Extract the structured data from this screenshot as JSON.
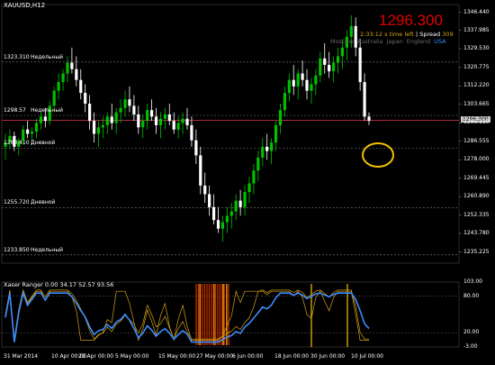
{
  "chart": {
    "symbol": "XAUUSD,H12",
    "current_price": "1296.300",
    "time_left": "2:33:12 s time left",
    "spread_label": "Spread",
    "spread_value": "309",
    "sessions": [
      "Moscow",
      "Australia",
      "Japan",
      "England",
      "USA"
    ],
    "active_session": "USA",
    "price_tag": "1296.300",
    "levels": [
      {
        "value": "1323.310",
        "name": "Недельный"
      },
      {
        "value": "1298.57",
        "name": "Недельный"
      },
      {
        "value": "1283.410",
        "name": "Дневной"
      },
      {
        "value": "1255.720",
        "name": "Дневной"
      },
      {
        "value": "1233.850",
        "name": "Недельный"
      }
    ],
    "price_axis": [
      "1346.440",
      "1337.985",
      "1329.530",
      "1320.775",
      "1312.220",
      "1303.665",
      "1295.110",
      "1286.555",
      "1278.000",
      "1269.445",
      "1260.890",
      "1252.335",
      "1243.780",
      "1235.225"
    ],
    "time_axis": [
      "31 Mar 2014",
      "10 Apr 00:00",
      "23 Apr 00:00",
      "5 May 00:00",
      "15 May 00:00",
      "27 May 00:00",
      "6 Jun 00:00",
      "18 Jun 00:00",
      "30 Jun 00:00",
      "10 Jul 00:00"
    ]
  },
  "indicator": {
    "label": "Xaser Ranger  0.00 34.17 52.57 93.56",
    "axis": [
      "103.00",
      "80.00",
      "20.00",
      "-3.00"
    ]
  },
  "colors": {
    "bull": "#00c000",
    "bear": "#ffffff",
    "current_line": "#c0304a",
    "level_line": "#808080",
    "circle": "#f0c000",
    "ind_blue": "#3b8cff",
    "ind_orange": "#d4a017",
    "ind_red": "#d03000"
  },
  "chart_data": {
    "type": "candlestick",
    "title": "XAUUSD,H12",
    "ylim": [
      1230,
      1350
    ],
    "ohlc": [
      [
        1284,
        1290,
        1278,
        1286
      ],
      [
        1286,
        1292,
        1283,
        1289
      ],
      [
        1289,
        1291,
        1282,
        1284
      ],
      [
        1284,
        1288,
        1280,
        1287
      ],
      [
        1287,
        1294,
        1285,
        1292
      ],
      [
        1292,
        1296,
        1288,
        1290
      ],
      [
        1290,
        1293,
        1285,
        1291
      ],
      [
        1291,
        1297,
        1288,
        1295
      ],
      [
        1295,
        1300,
        1292,
        1298
      ],
      [
        1298,
        1302,
        1293,
        1296
      ],
      [
        1296,
        1305,
        1294,
        1303
      ],
      [
        1303,
        1312,
        1300,
        1310
      ],
      [
        1310,
        1318,
        1306,
        1314
      ],
      [
        1314,
        1320,
        1310,
        1318
      ],
      [
        1318,
        1326,
        1314,
        1323
      ],
      [
        1323,
        1330,
        1318,
        1320
      ],
      [
        1320,
        1326,
        1312,
        1315
      ],
      [
        1315,
        1320,
        1306,
        1309
      ],
      [
        1309,
        1313,
        1300,
        1304
      ],
      [
        1304,
        1308,
        1292,
        1296
      ],
      [
        1296,
        1300,
        1286,
        1290
      ],
      [
        1290,
        1296,
        1284,
        1293
      ],
      [
        1293,
        1298,
        1288,
        1294
      ],
      [
        1294,
        1300,
        1290,
        1298
      ],
      [
        1298,
        1304,
        1292,
        1295
      ],
      [
        1295,
        1302,
        1290,
        1300
      ],
      [
        1300,
        1306,
        1295,
        1302
      ],
      [
        1302,
        1310,
        1298,
        1306
      ],
      [
        1306,
        1312,
        1300,
        1303
      ],
      [
        1303,
        1308,
        1296,
        1299
      ],
      [
        1299,
        1303,
        1290,
        1293
      ],
      [
        1293,
        1299,
        1288,
        1296
      ],
      [
        1296,
        1304,
        1292,
        1301
      ],
      [
        1301,
        1306,
        1296,
        1298
      ],
      [
        1298,
        1302,
        1290,
        1294
      ],
      [
        1294,
        1300,
        1288,
        1297
      ],
      [
        1297,
        1302,
        1292,
        1299
      ],
      [
        1299,
        1304,
        1294,
        1296
      ],
      [
        1296,
        1300,
        1290,
        1292
      ],
      [
        1292,
        1298,
        1288,
        1295
      ],
      [
        1295,
        1300,
        1290,
        1297
      ],
      [
        1297,
        1302,
        1292,
        1294
      ],
      [
        1294,
        1298,
        1284,
        1287
      ],
      [
        1287,
        1292,
        1276,
        1280
      ],
      [
        1280,
        1284,
        1262,
        1266
      ],
      [
        1266,
        1272,
        1258,
        1262
      ],
      [
        1262,
        1266,
        1252,
        1256
      ],
      [
        1256,
        1262,
        1248,
        1250
      ],
      [
        1250,
        1256,
        1244,
        1246
      ],
      [
        1246,
        1252,
        1240,
        1249
      ],
      [
        1249,
        1256,
        1244,
        1252
      ],
      [
        1252,
        1258,
        1246,
        1254
      ],
      [
        1254,
        1262,
        1250,
        1259
      ],
      [
        1259,
        1264,
        1252,
        1256
      ],
      [
        1256,
        1266,
        1252,
        1263
      ],
      [
        1263,
        1270,
        1258,
        1267
      ],
      [
        1267,
        1276,
        1262,
        1273
      ],
      [
        1273,
        1282,
        1268,
        1279
      ],
      [
        1279,
        1288,
        1275,
        1284
      ],
      [
        1284,
        1290,
        1278,
        1282
      ],
      [
        1282,
        1288,
        1276,
        1286
      ],
      [
        1286,
        1296,
        1282,
        1294
      ],
      [
        1294,
        1304,
        1290,
        1301
      ],
      [
        1301,
        1312,
        1298,
        1309
      ],
      [
        1309,
        1318,
        1305,
        1315
      ],
      [
        1315,
        1322,
        1308,
        1312
      ],
      [
        1312,
        1320,
        1306,
        1318
      ],
      [
        1318,
        1324,
        1312,
        1315
      ],
      [
        1315,
        1320,
        1306,
        1310
      ],
      [
        1310,
        1316,
        1304,
        1313
      ],
      [
        1313,
        1320,
        1308,
        1317
      ],
      [
        1317,
        1328,
        1314,
        1325
      ],
      [
        1325,
        1332,
        1318,
        1322
      ],
      [
        1322,
        1328,
        1316,
        1319
      ],
      [
        1319,
        1326,
        1314,
        1323
      ],
      [
        1323,
        1330,
        1318,
        1326
      ],
      [
        1326,
        1334,
        1320,
        1330
      ],
      [
        1330,
        1338,
        1324,
        1335
      ],
      [
        1335,
        1345,
        1330,
        1340
      ],
      [
        1340,
        1344,
        1326,
        1330
      ],
      [
        1330,
        1334,
        1310,
        1314
      ],
      [
        1314,
        1318,
        1296,
        1298
      ],
      [
        1298,
        1300,
        1294,
        1296
      ]
    ]
  }
}
